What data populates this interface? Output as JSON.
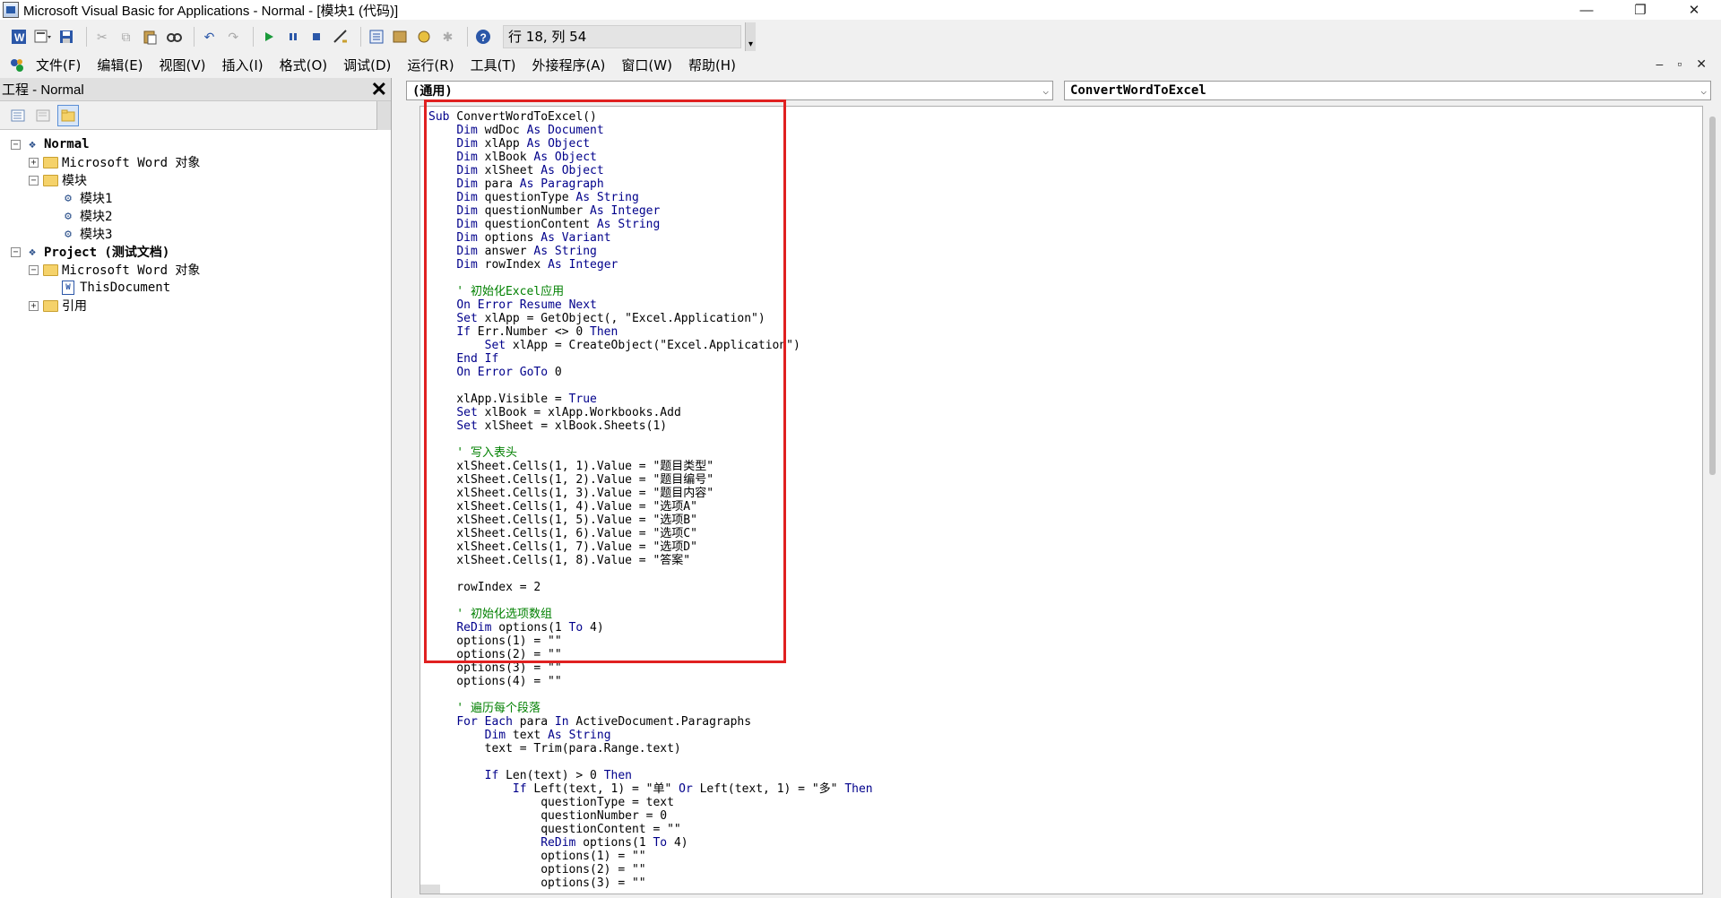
{
  "window": {
    "title": "Microsoft Visual Basic for Applications - Normal - [模块1 (代码)]",
    "controls": [
      "—",
      "❐",
      "✕"
    ]
  },
  "toolbar": {
    "status": "行 18, 列 54"
  },
  "menu": {
    "items": [
      "文件(F)",
      "编辑(E)",
      "视图(V)",
      "插入(I)",
      "格式(O)",
      "调试(D)",
      "运行(R)",
      "工具(T)",
      "外接程序(A)",
      "窗口(W)",
      "帮助(H)"
    ],
    "mdi_controls": [
      "–",
      "▫",
      "✕"
    ]
  },
  "project_panel": {
    "title": "工程 - Normal",
    "close": "✕",
    "tree": [
      {
        "label": "Normal",
        "expander": "−",
        "indent": 0,
        "icon": "project-icon",
        "bold": true
      },
      {
        "label": "Microsoft Word 对象",
        "expander": "+",
        "indent": 1,
        "icon": "folder-icon"
      },
      {
        "label": "模块",
        "expander": "−",
        "indent": 1,
        "icon": "folder-icon"
      },
      {
        "label": "模块1",
        "expander": "",
        "indent": 2,
        "icon": "module-icon"
      },
      {
        "label": "模块2",
        "expander": "",
        "indent": 2,
        "icon": "module-icon"
      },
      {
        "label": "模块3",
        "expander": "",
        "indent": 2,
        "icon": "module-icon"
      },
      {
        "label": "Project (测试文档)",
        "expander": "−",
        "indent": 0,
        "icon": "project-icon",
        "bold": true
      },
      {
        "label": "Microsoft Word 对象",
        "expander": "−",
        "indent": 1,
        "icon": "folder-icon"
      },
      {
        "label": "ThisDocument",
        "expander": "",
        "indent": 2,
        "icon": "document-icon"
      },
      {
        "label": "引用",
        "expander": "+",
        "indent": 1,
        "icon": "folder-icon"
      }
    ]
  },
  "code_window": {
    "object_combo": "(通用)",
    "procedure_combo": "ConvertWordToExcel",
    "lines": [
      "Sub ConvertWordToExcel()",
      "    Dim wdDoc As Document",
      "    Dim xlApp As Object",
      "    Dim xlBook As Object",
      "    Dim xlSheet As Object",
      "    Dim para As Paragraph",
      "    Dim questionType As String",
      "    Dim questionNumber As Integer",
      "    Dim questionContent As String",
      "    Dim options As Variant",
      "    Dim answer As String",
      "    Dim rowIndex As Integer",
      "",
      "    ' 初始化Excel应用",
      "    On Error Resume Next",
      "    Set xlApp = GetObject(, \"Excel.Application\")",
      "    If Err.Number <> 0 Then",
      "        Set xlApp = CreateObject(\"Excel.Application\")",
      "    End If",
      "    On Error GoTo 0",
      "",
      "    xlApp.Visible = True",
      "    Set xlBook = xlApp.Workbooks.Add",
      "    Set xlSheet = xlBook.Sheets(1)",
      "",
      "    ' 写入表头",
      "    xlSheet.Cells(1, 1).Value = \"题目类型\"",
      "    xlSheet.Cells(1, 2).Value = \"题目编号\"",
      "    xlSheet.Cells(1, 3).Value = \"题目内容\"",
      "    xlSheet.Cells(1, 4).Value = \"选项A\"",
      "    xlSheet.Cells(1, 5).Value = \"选项B\"",
      "    xlSheet.Cells(1, 6).Value = \"选项C\"",
      "    xlSheet.Cells(1, 7).Value = \"选项D\"",
      "    xlSheet.Cells(1, 8).Value = \"答案\"",
      "",
      "    rowIndex = 2",
      "",
      "    ' 初始化选项数组",
      "    ReDim options(1 To 4)",
      "    options(1) = \"\"",
      "    options(2) = \"\"",
      "    options(3) = \"\"",
      "    options(4) = \"\"",
      "",
      "    ' 遍历每个段落",
      "    For Each para In ActiveDocument.Paragraphs",
      "        Dim text As String",
      "        text = Trim(para.Range.text)",
      "",
      "        If Len(text) > 0 Then",
      "            If Left(text, 1) = \"单\" Or Left(text, 1) = \"多\" Then",
      "                questionType = text",
      "                questionNumber = 0",
      "                questionContent = \"\"",
      "                ReDim options(1 To 4)",
      "                options(1) = \"\"",
      "                options(2) = \"\"",
      "                options(3) = \"\""
    ]
  },
  "colors": {
    "keyword": "#00008b",
    "comment": "#008000",
    "highlight_box": "#e02020"
  }
}
